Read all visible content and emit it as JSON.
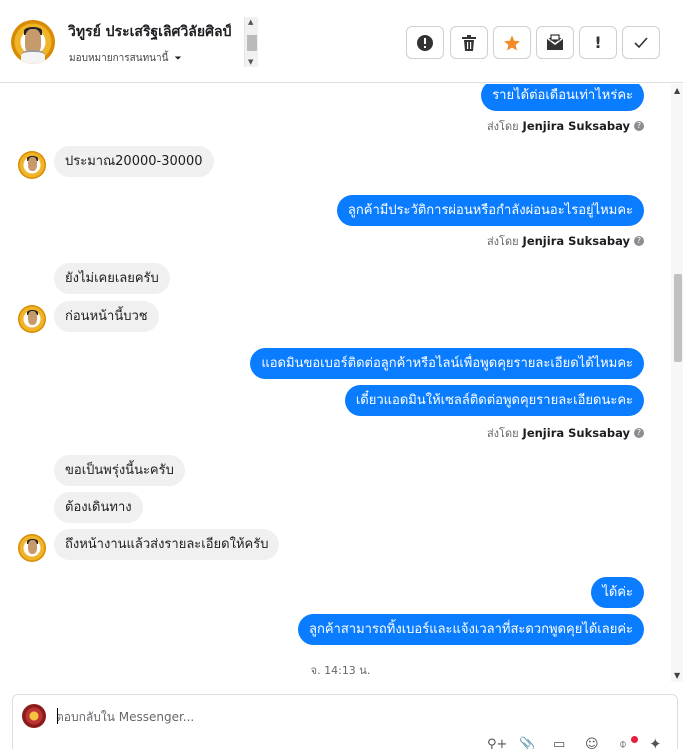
{
  "header": {
    "contact_name": "วิทูรย์ ประเสริฐเลิศวิลัยศิลป์",
    "assign_label": "มอบหมายการสนทนานี้",
    "caret": "⏷",
    "toolbar": [
      {
        "name": "spam-button",
        "icon": "alert-circle-icon",
        "glyph": "!"
      },
      {
        "name": "delete-button",
        "icon": "trash-icon",
        "glyph": "🗑"
      },
      {
        "name": "star-button",
        "icon": "star-icon",
        "glyph": "★"
      },
      {
        "name": "mark-unread-button",
        "icon": "envelope-icon",
        "glyph": "✉"
      },
      {
        "name": "follow-up-button",
        "icon": "exclamation-icon",
        "glyph": "!"
      },
      {
        "name": "done-button",
        "icon": "check-icon",
        "glyph": "✓"
      }
    ]
  },
  "sent_by": {
    "prefix": "ส่งโดย",
    "agent": "Jenjira Suksabay",
    "help": "?"
  },
  "messages": {
    "m1": "รายได้ต่อเดือนเท่าไหร่คะ",
    "m2": "ประมาณ20000-30000",
    "m3": "ลูกค้ามีประวัติการผ่อนหรือกำลังผ่อนอะไรอยู่ไหมคะ",
    "m4": "ยังไม่เคยเลยครับ",
    "m5": "ก่อนหน้านี้บวช",
    "m6": "แอดมินขอเบอร์ติดต่อลูกค้าหรือไลน์เพื่อพูดคุยรายละเอียดได้ไหมคะ",
    "m7": "เดี๋ยวแอดมินให้เซลล์ติดต่อพูดคุยรายละเอียดนะคะ",
    "m8": "ขอเป็นพรุ่งนี้นะครับ",
    "m9": "ต้องเดินทาง",
    "m10": "ถึงหน้างานแล้วส่งรายละเอียดให้ครับ",
    "m11": "ได้ค่ะ",
    "m12": "ลูกค้าสามารถทิ้งเบอร์และแจ้งเวลาที่สะดวกพูดคุยได้เลยค่ะ"
  },
  "timestamp": "จ. 14:13 น.",
  "composer": {
    "placeholder": "ตอบกลับใน Messenger..."
  },
  "colors": {
    "outgoing": "#0a7cff",
    "incoming": "#f0f0f0",
    "star": "#f28c28"
  }
}
